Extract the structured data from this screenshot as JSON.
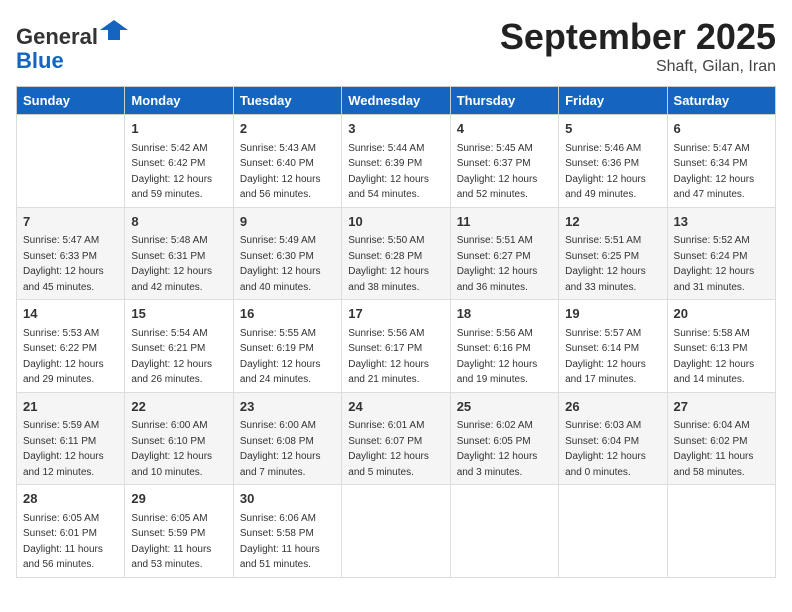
{
  "header": {
    "logo_line1": "General",
    "logo_line2": "Blue",
    "month_title": "September 2025",
    "location": "Shaft, Gilan, Iran"
  },
  "days_of_week": [
    "Sunday",
    "Monday",
    "Tuesday",
    "Wednesday",
    "Thursday",
    "Friday",
    "Saturday"
  ],
  "weeks": [
    [
      {
        "day": "",
        "info": ""
      },
      {
        "day": "1",
        "info": "Sunrise: 5:42 AM\nSunset: 6:42 PM\nDaylight: 12 hours\nand 59 minutes."
      },
      {
        "day": "2",
        "info": "Sunrise: 5:43 AM\nSunset: 6:40 PM\nDaylight: 12 hours\nand 56 minutes."
      },
      {
        "day": "3",
        "info": "Sunrise: 5:44 AM\nSunset: 6:39 PM\nDaylight: 12 hours\nand 54 minutes."
      },
      {
        "day": "4",
        "info": "Sunrise: 5:45 AM\nSunset: 6:37 PM\nDaylight: 12 hours\nand 52 minutes."
      },
      {
        "day": "5",
        "info": "Sunrise: 5:46 AM\nSunset: 6:36 PM\nDaylight: 12 hours\nand 49 minutes."
      },
      {
        "day": "6",
        "info": "Sunrise: 5:47 AM\nSunset: 6:34 PM\nDaylight: 12 hours\nand 47 minutes."
      }
    ],
    [
      {
        "day": "7",
        "info": "Sunrise: 5:47 AM\nSunset: 6:33 PM\nDaylight: 12 hours\nand 45 minutes."
      },
      {
        "day": "8",
        "info": "Sunrise: 5:48 AM\nSunset: 6:31 PM\nDaylight: 12 hours\nand 42 minutes."
      },
      {
        "day": "9",
        "info": "Sunrise: 5:49 AM\nSunset: 6:30 PM\nDaylight: 12 hours\nand 40 minutes."
      },
      {
        "day": "10",
        "info": "Sunrise: 5:50 AM\nSunset: 6:28 PM\nDaylight: 12 hours\nand 38 minutes."
      },
      {
        "day": "11",
        "info": "Sunrise: 5:51 AM\nSunset: 6:27 PM\nDaylight: 12 hours\nand 36 minutes."
      },
      {
        "day": "12",
        "info": "Sunrise: 5:51 AM\nSunset: 6:25 PM\nDaylight: 12 hours\nand 33 minutes."
      },
      {
        "day": "13",
        "info": "Sunrise: 5:52 AM\nSunset: 6:24 PM\nDaylight: 12 hours\nand 31 minutes."
      }
    ],
    [
      {
        "day": "14",
        "info": "Sunrise: 5:53 AM\nSunset: 6:22 PM\nDaylight: 12 hours\nand 29 minutes."
      },
      {
        "day": "15",
        "info": "Sunrise: 5:54 AM\nSunset: 6:21 PM\nDaylight: 12 hours\nand 26 minutes."
      },
      {
        "day": "16",
        "info": "Sunrise: 5:55 AM\nSunset: 6:19 PM\nDaylight: 12 hours\nand 24 minutes."
      },
      {
        "day": "17",
        "info": "Sunrise: 5:56 AM\nSunset: 6:17 PM\nDaylight: 12 hours\nand 21 minutes."
      },
      {
        "day": "18",
        "info": "Sunrise: 5:56 AM\nSunset: 6:16 PM\nDaylight: 12 hours\nand 19 minutes."
      },
      {
        "day": "19",
        "info": "Sunrise: 5:57 AM\nSunset: 6:14 PM\nDaylight: 12 hours\nand 17 minutes."
      },
      {
        "day": "20",
        "info": "Sunrise: 5:58 AM\nSunset: 6:13 PM\nDaylight: 12 hours\nand 14 minutes."
      }
    ],
    [
      {
        "day": "21",
        "info": "Sunrise: 5:59 AM\nSunset: 6:11 PM\nDaylight: 12 hours\nand 12 minutes."
      },
      {
        "day": "22",
        "info": "Sunrise: 6:00 AM\nSunset: 6:10 PM\nDaylight: 12 hours\nand 10 minutes."
      },
      {
        "day": "23",
        "info": "Sunrise: 6:00 AM\nSunset: 6:08 PM\nDaylight: 12 hours\nand 7 minutes."
      },
      {
        "day": "24",
        "info": "Sunrise: 6:01 AM\nSunset: 6:07 PM\nDaylight: 12 hours\nand 5 minutes."
      },
      {
        "day": "25",
        "info": "Sunrise: 6:02 AM\nSunset: 6:05 PM\nDaylight: 12 hours\nand 3 minutes."
      },
      {
        "day": "26",
        "info": "Sunrise: 6:03 AM\nSunset: 6:04 PM\nDaylight: 12 hours\nand 0 minutes."
      },
      {
        "day": "27",
        "info": "Sunrise: 6:04 AM\nSunset: 6:02 PM\nDaylight: 11 hours\nand 58 minutes."
      }
    ],
    [
      {
        "day": "28",
        "info": "Sunrise: 6:05 AM\nSunset: 6:01 PM\nDaylight: 11 hours\nand 56 minutes."
      },
      {
        "day": "29",
        "info": "Sunrise: 6:05 AM\nSunset: 5:59 PM\nDaylight: 11 hours\nand 53 minutes."
      },
      {
        "day": "30",
        "info": "Sunrise: 6:06 AM\nSunset: 5:58 PM\nDaylight: 11 hours\nand 51 minutes."
      },
      {
        "day": "",
        "info": ""
      },
      {
        "day": "",
        "info": ""
      },
      {
        "day": "",
        "info": ""
      },
      {
        "day": "",
        "info": ""
      }
    ]
  ]
}
